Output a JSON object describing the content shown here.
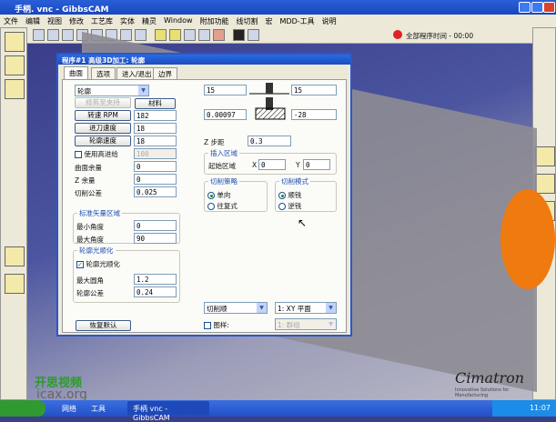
{
  "window": {
    "title": "手柄. vnc - GibbsCAM"
  },
  "menu": [
    "文件",
    "编辑",
    "视图",
    "修改",
    "工艺库",
    "实体",
    "精灵",
    "Window",
    "附加功能",
    "线切割",
    "宏",
    "MDD-工具",
    "说明"
  ],
  "toolbar": {
    "timer": "全部程序时间 - 00:00"
  },
  "watermark": {
    "brand": "开思视频",
    "site": "icax.org",
    "logo": "Cimatron",
    "logo_tagline": "Innovative Solutions for Manufacturing"
  },
  "dialog": {
    "title": "程序#1 高级3D加工: 轮廓",
    "tabs": [
      "曲面",
      "选项",
      "进入/退出",
      "边界"
    ],
    "mode_select": "轮廓",
    "trim_button": "修剪至夹持",
    "material_button": "材料",
    "rpm_button": "转速 RPM",
    "rpm": "182",
    "feed_button": "进刀速度",
    "feed": "18",
    "contour_button": "轮廓速度",
    "contour_speed": "18",
    "high_feed_label": "使用高进给",
    "high_feed": "100",
    "surface_stock_label": "曲面余量",
    "surface_stock": "0",
    "z_stock_label": "Z 余量",
    "z_stock": "0",
    "tolerance_label": "切削公差",
    "tolerance": "0.025",
    "normal_group": "标准矢量区域",
    "min_angle_label": "最小角度",
    "min_angle": "0",
    "max_angle_label": "最大角度",
    "max_angle": "90",
    "smooth_group": "轮廓光顺化",
    "smooth_check": "轮廓光顺化",
    "max_radius_label": "最大圆角",
    "max_radius": "1.2",
    "contour_tol_label": "轮廓公差",
    "contour_tol": "0.24",
    "restore_button": "恢复默认",
    "top_left": "15",
    "top_right": "15",
    "bottom_left": "0.00097",
    "bottom_right": "-28",
    "zstep_label": "Z 步距",
    "zstep": "0.3",
    "insert_group": "插入区域",
    "start_label": "起始区域",
    "x_label": "X",
    "x_val": "0",
    "y_label": "Y",
    "y_val": "0",
    "strategy_group": "切削策略",
    "strategy_options": [
      "单向",
      "往复式"
    ],
    "direction_group": "切削模式",
    "direction_options": [
      "顺铣",
      "逆铣"
    ],
    "order_select": "切削顺",
    "plane_select": "1: XY 平面",
    "pattern_label": "图样:",
    "pattern_select": "1: 群组"
  },
  "taskbar": {
    "items": [
      "网络",
      "工具"
    ],
    "task": "手柄 vnc - GibbsCAM",
    "clock": "11:07"
  }
}
